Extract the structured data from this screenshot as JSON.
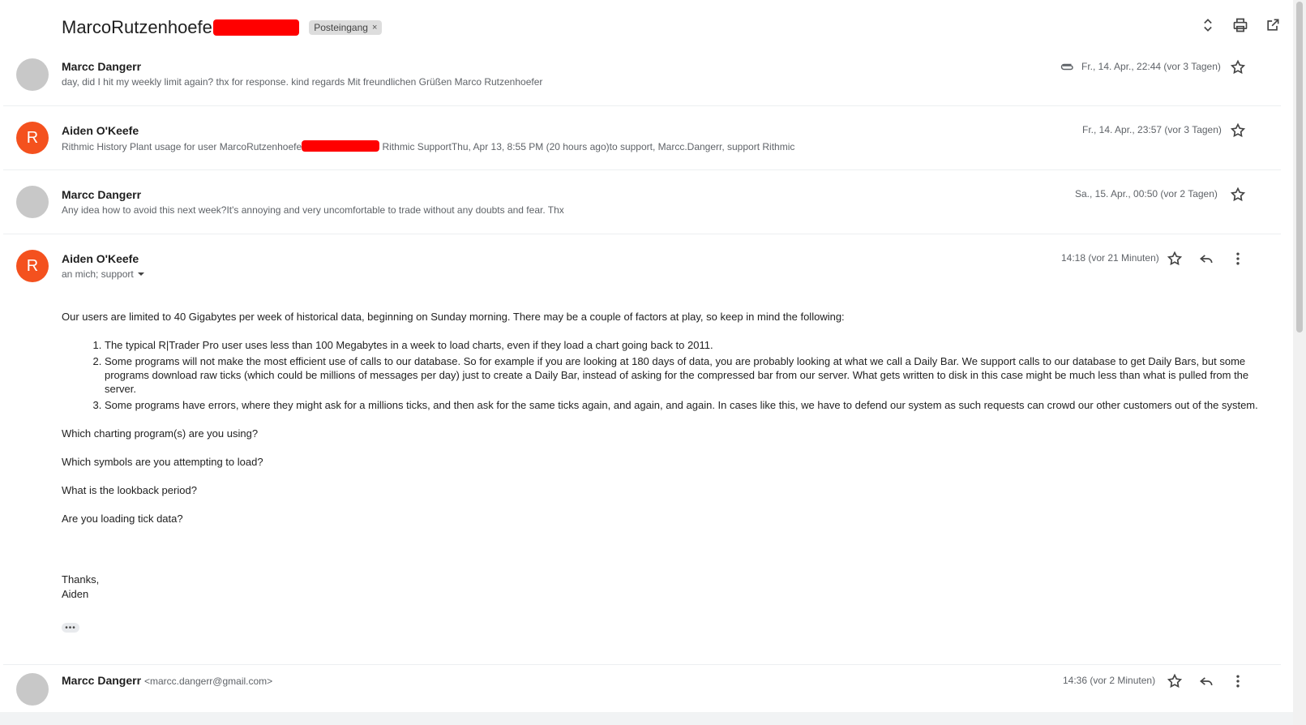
{
  "thread": {
    "subject": "MarcoRutzenhoefer",
    "label_chip": "Posteingang",
    "chip_close": "×"
  },
  "messages": [
    {
      "sender": "Marcc Dangerr",
      "snippet": "day, did I hit my weekly limit again? thx for response. kind regards Mit freundlichen Grüßen Marco Rutzenhoefer",
      "date": "Fr., 14. Apr., 22:44 (vor 3 Tagen)",
      "has_attachment": true,
      "avatar": "gray"
    },
    {
      "sender": "Aiden O'Keefe",
      "snippet_before": "Rithmic History Plant usage for user MarcoRutzenhoefe",
      "snippet_after": " Rithmic SupportThu, Apr 13, 8:55 PM (20 hours ago)to support, Marcc.Dangerr, support Rithmic",
      "date": "Fr., 14. Apr., 23:57 (vor 3 Tagen)",
      "avatar_letter": "R"
    },
    {
      "sender": "Marcc Dangerr",
      "snippet": "Any idea how to avoid this next week?It's annoying and very uncomfortable to trade without any doubts and fear. Thx",
      "date": "Sa., 15. Apr., 00:50 (vor 2 Tagen)",
      "avatar": "gray"
    }
  ],
  "open_message": {
    "sender": "Aiden O'Keefe",
    "avatar_letter": "R",
    "recipients": "an mich; support",
    "time": "14:18 (vor 21 Minuten)",
    "intro": "Our users are limited to 40 Gigabytes per week of historical data, beginning on Sunday morning. There may be a couple of factors at play, so keep in mind the following:",
    "list": [
      "The typical R|Trader Pro user uses less than 100 Megabytes in a week to load charts, even if they load a chart going back to 2011.",
      "Some programs will not make the most efficient use of calls to our database. So for example if you are looking at 180 days of data, you are probably looking at what we call a Daily Bar. We support calls to our database to get Daily Bars, but some programs download raw ticks (which could be millions of messages per day) just to create a Daily Bar, instead of asking for the compressed bar from our server. What gets written to disk in this case might be much less than what is pulled from the server.",
      "Some programs have errors, where they might ask for a millions ticks, and then ask for the same ticks again, and again, and again. In cases like this, we have to defend our system as such requests can crowd our other customers out of the system."
    ],
    "q1": "Which charting program(s) are you using?",
    "q2": "Which symbols are you attempting to load?",
    "q3": "What is the lookback period?",
    "q4": "Are you loading tick data?",
    "thanks": "Thanks,",
    "signature": "Aiden",
    "more_button": "•••"
  },
  "last_message": {
    "sender": "Marcc Dangerr",
    "email": "<marcc.dangerr@gmail.com>",
    "time": "14:36 (vor 2 Minuten)",
    "avatar": "gray"
  },
  "icons": {
    "expand": "unfold-icon",
    "print": "print-icon",
    "open_new": "open-in-new-icon",
    "star": "star-icon",
    "reply": "reply-icon",
    "more": "more-vert-icon",
    "attachment": "paperclip-icon"
  },
  "colors": {
    "accent_avatar": "#f4511e",
    "redaction": "#ff0000"
  }
}
